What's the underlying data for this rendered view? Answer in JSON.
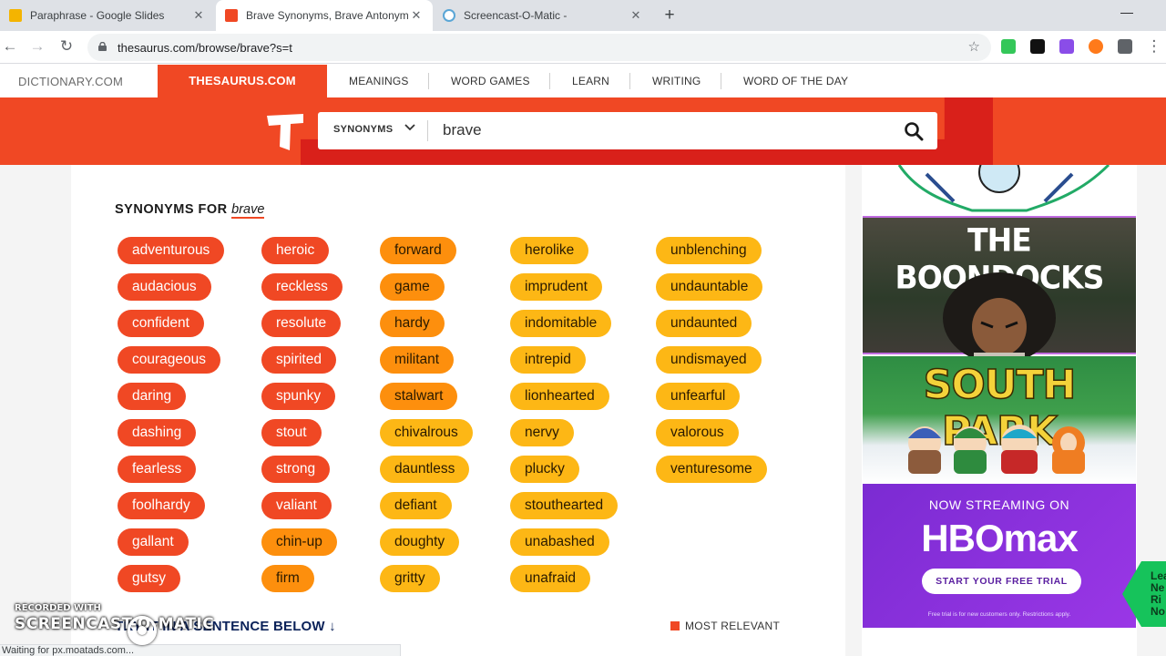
{
  "browser": {
    "tabs": [
      {
        "label": "Paraphrase - Google Slides",
        "color": "#f4b400"
      },
      {
        "label": "Brave Synonyms, Brave Antonyms | Thesaurus.com",
        "color": "#f04824"
      },
      {
        "label": "Screencast-O-Matic -",
        "color": "#5aa6d6"
      }
    ],
    "new_tab": "+",
    "url": "thesaurus.com/browse/brave?s=t"
  },
  "site_nav": {
    "dictionary": "DICTIONARY.COM",
    "thesaurus": "THESAURUS.COM",
    "items": [
      "MEANINGS",
      "WORD GAMES",
      "LEARN",
      "WRITING",
      "WORD OF THE DAY"
    ]
  },
  "search": {
    "mode": "SYNONYMS",
    "query": "brave"
  },
  "results": {
    "heading": "SYNONYMS FOR",
    "word": "brave",
    "colors": {
      "most": "#f04824",
      "medium": "#fd8f0d",
      "less": "#fdb715"
    },
    "columns": [
      [
        {
          "w": "adventurous",
          "r": "most"
        },
        {
          "w": "audacious",
          "r": "most"
        },
        {
          "w": "confident",
          "r": "most"
        },
        {
          "w": "courageous",
          "r": "most"
        },
        {
          "w": "daring",
          "r": "most"
        },
        {
          "w": "dashing",
          "r": "most"
        },
        {
          "w": "fearless",
          "r": "most"
        },
        {
          "w": "foolhardy",
          "r": "most"
        },
        {
          "w": "gallant",
          "r": "most"
        },
        {
          "w": "gutsy",
          "r": "most"
        }
      ],
      [
        {
          "w": "heroic",
          "r": "most"
        },
        {
          "w": "reckless",
          "r": "most"
        },
        {
          "w": "resolute",
          "r": "most"
        },
        {
          "w": "spirited",
          "r": "most"
        },
        {
          "w": "spunky",
          "r": "most"
        },
        {
          "w": "stout",
          "r": "most"
        },
        {
          "w": "strong",
          "r": "most"
        },
        {
          "w": "valiant",
          "r": "most"
        },
        {
          "w": "chin-up",
          "r": "medium"
        },
        {
          "w": "firm",
          "r": "medium"
        }
      ],
      [
        {
          "w": "forward",
          "r": "medium"
        },
        {
          "w": "game",
          "r": "medium"
        },
        {
          "w": "hardy",
          "r": "medium"
        },
        {
          "w": "militant",
          "r": "medium"
        },
        {
          "w": "stalwart",
          "r": "medium"
        },
        {
          "w": "chivalrous",
          "r": "less"
        },
        {
          "w": "dauntless",
          "r": "less"
        },
        {
          "w": "defiant",
          "r": "less"
        },
        {
          "w": "doughty",
          "r": "less"
        },
        {
          "w": "gritty",
          "r": "less"
        }
      ],
      [
        {
          "w": "herolike",
          "r": "less"
        },
        {
          "w": "imprudent",
          "r": "less"
        },
        {
          "w": "indomitable",
          "r": "less"
        },
        {
          "w": "intrepid",
          "r": "less"
        },
        {
          "w": "lionhearted",
          "r": "less"
        },
        {
          "w": "nervy",
          "r": "less"
        },
        {
          "w": "plucky",
          "r": "less"
        },
        {
          "w": "stouthearted",
          "r": "less"
        },
        {
          "w": "unabashed",
          "r": "less"
        },
        {
          "w": "unafraid",
          "r": "less"
        }
      ],
      [
        {
          "w": "unblenching",
          "r": "less"
        },
        {
          "w": "undauntable",
          "r": "less"
        },
        {
          "w": "undaunted",
          "r": "less"
        },
        {
          "w": "undismayed",
          "r": "less"
        },
        {
          "w": "unfearful",
          "r": "less"
        },
        {
          "w": "valorous",
          "r": "less"
        },
        {
          "w": "venturesome",
          "r": "less"
        }
      ]
    ],
    "try_label": "TRY",
    "try_rest": "IT IN A SENTENCE BELOW",
    "try_arrow": "↓",
    "legend": "MOST RELEVANT"
  },
  "ad": {
    "boondocks": "THE BOONDOCKS",
    "southpark": "SOUTH PARK",
    "streaming": "NOW STREAMING ON",
    "hbo": "HBOmax",
    "cta": "START YOUR FREE TRIAL",
    "fine": "Free trial is for new customers only. Restrictions apply."
  },
  "badge": "Lea\nNe\nRi\nNo",
  "watermark": {
    "line1": "RECORDED WITH",
    "line2": "SCREENCAST-O-MATIC"
  },
  "status": "Waiting for px.moatads.com..."
}
